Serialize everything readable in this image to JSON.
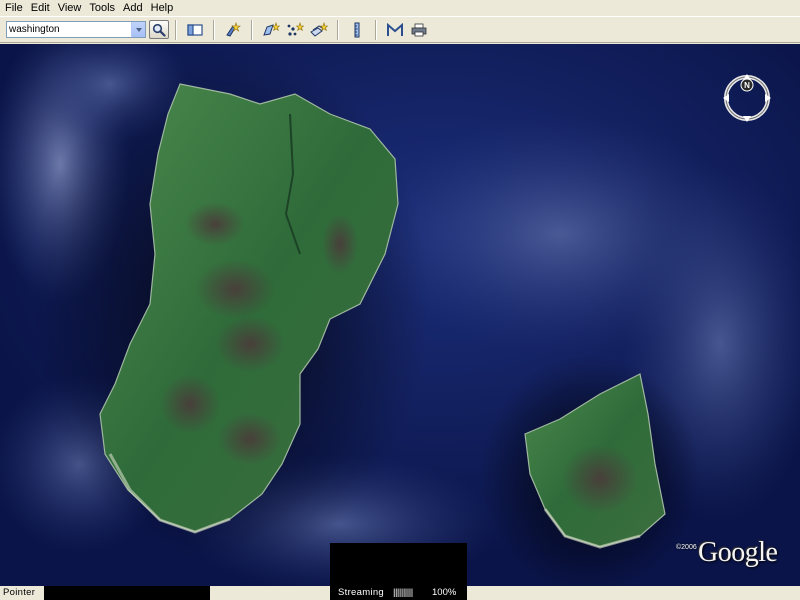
{
  "menu": {
    "items": [
      "File",
      "Edit",
      "View",
      "Tools",
      "Add",
      "Help"
    ]
  },
  "search": {
    "value": "washington"
  },
  "toolbar": {
    "icons": [
      "sidebar-toggle-icon",
      "placemark-icon",
      "polygon-icon",
      "path-icon",
      "image-overlay-icon",
      "ruler-icon",
      "email-icon",
      "print-icon"
    ]
  },
  "map": {
    "compass_label": "N",
    "copyright": "©2006",
    "logo": "Google"
  },
  "status": {
    "pointer_label": "Pointer",
    "streaming_label": "Streaming",
    "streaming_bars": "||||||||||",
    "streaming_percent": "100%"
  },
  "colors": {
    "ocean": "#0c1a5a",
    "land": "#2f6b35",
    "chrome": "#ece9d8"
  }
}
